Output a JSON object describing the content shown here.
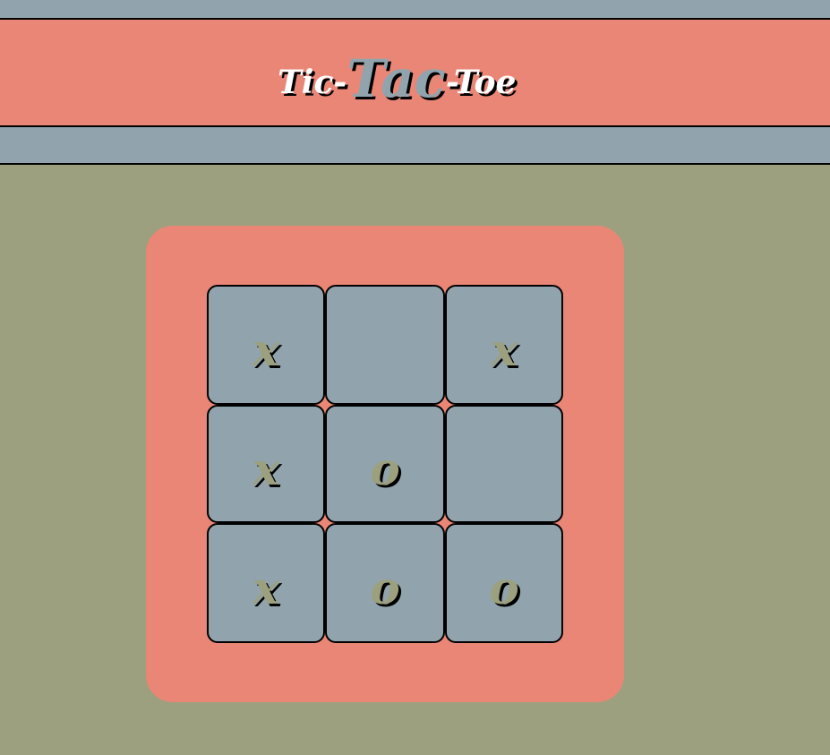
{
  "header": {
    "title_part1": "Tic-",
    "title_part2": "Tac",
    "title_part3": "-Toe"
  },
  "board": {
    "cells": [
      "x",
      "",
      "x",
      "x",
      "o",
      "",
      "x",
      "o",
      "o"
    ]
  },
  "colors": {
    "background": "#9ca07e",
    "strip": "#91a4ad",
    "accent": "#ea8676",
    "mark": "#9ca07e",
    "title_text": "#ffffff"
  }
}
